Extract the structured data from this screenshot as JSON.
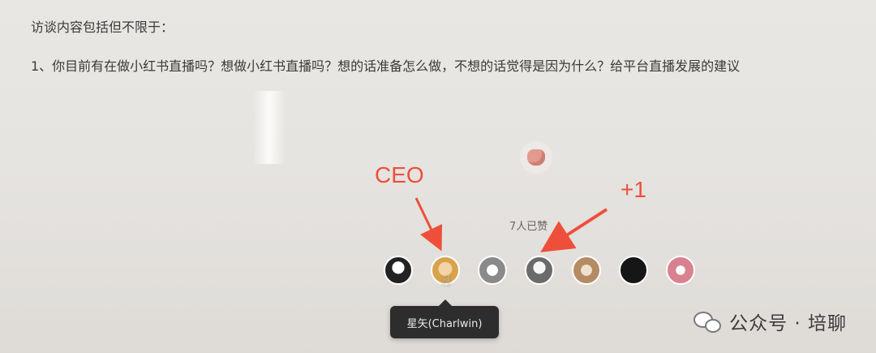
{
  "document": {
    "intro": "访谈内容包括但不限于：",
    "question1": "1、你目前有在做小红书直播吗？想做小红书直播吗？想的话准备怎么做，不想的话觉得是因为什么？给平台直播发展的建议"
  },
  "reactions": {
    "like_icon": "thumbs-up-icon",
    "count_text": "7人已赞",
    "avatars": [
      {
        "icon": "avatar-1"
      },
      {
        "icon": "avatar-2"
      },
      {
        "icon": "avatar-3"
      },
      {
        "icon": "avatar-4"
      },
      {
        "icon": "avatar-5"
      },
      {
        "icon": "avatar-6"
      },
      {
        "icon": "avatar-7"
      }
    ],
    "tooltip": "星矢(Charlwin)"
  },
  "annotations": {
    "ceo": "CEO",
    "plus_one": "+1",
    "color": "#ee4f3a"
  },
  "watermark": {
    "text": "公众号 · 培聊",
    "icon": "wechat-icon"
  }
}
